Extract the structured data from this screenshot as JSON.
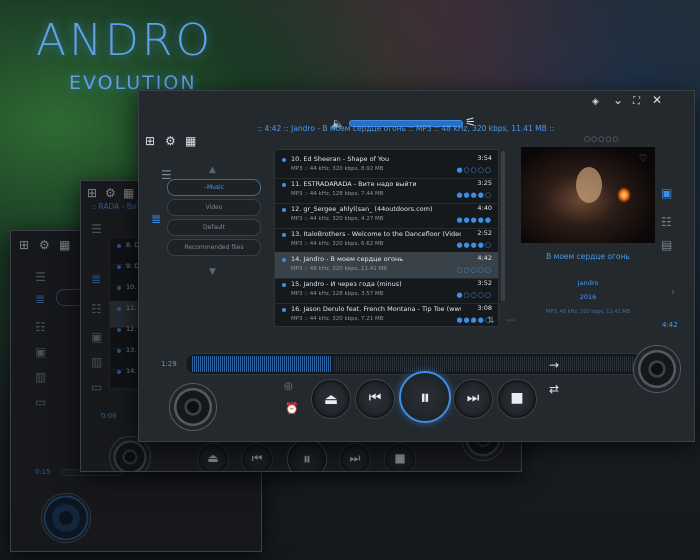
{
  "brand": {
    "title": "ANDRO",
    "subtitle": "EVOLUTION"
  },
  "colors": {
    "accent": "#3d8ee6",
    "bg": "#24292e"
  },
  "now_playing": {
    "line": ":: 4:42 :: Jandro - В моем сердце огонь :: MP3 :: 48 kHz, 320 kbps, 11.41 MB ::",
    "title": "В моем сердце огонь",
    "artist": "Jandro",
    "year": "2016",
    "format": "MP3, 48 kHz, 320 kbps, 11.41 MB",
    "elapsed": "1:29",
    "total": "4:42"
  },
  "nav": {
    "items": [
      "Music",
      "Video",
      "Default",
      "Recommended files"
    ]
  },
  "playlist": [
    {
      "title": "10. Ed Sheeran - Shape of You",
      "meta": "MP3 :: 44 kHz, 320 kbps, 8.92 MB",
      "duration": "3:54",
      "stars": "●○○○○"
    },
    {
      "title": "11. ESTRADARADA - Вите надо выйти",
      "meta": "MP3 :: 44 kHz, 128 kbps, 7.44 MB",
      "duration": "3:25",
      "stars": "●●●●○"
    },
    {
      "title": "12. gr_Sergee_ahlyl(san_ (44outdoors.com)",
      "meta": "MP3 :: 44 kHz, 320 kbps, 4.27 MB",
      "duration": "4:40",
      "stars": "●●●●●"
    },
    {
      "title": "13. ItaloBrothers - Welcome to the Dancefloor (Video Edit)",
      "meta": "MP3 :: 44 kHz, 320 kbps, 6.62 MB",
      "duration": "2:52",
      "stars": "●●●●○"
    },
    {
      "title": "14. Jandro - В моем сердце огонь",
      "meta": "MP3 :: 48 kHz, 320 kbps, 11.41 MB",
      "duration": "4:42",
      "stars": "○○○○○"
    },
    {
      "title": "15. Jandro - И через года (minus)",
      "meta": "MP3 :: 44 kHz, 128 kbps, 3.57 MB",
      "duration": "3:52",
      "stars": "●○○○○"
    },
    {
      "title": "16. Jason Derulo feat. French Montana - Tip Toe (www.rump...",
      "meta": "MP3 :: 44 kHz, 320 kbps, 7.21 MB",
      "duration": "3:08",
      "stars": "●●●●○"
    }
  ],
  "win2": {
    "line": ":: RADA - Вите на...",
    "rows": [
      "8. Dea...",
      "9. DJ ...",
      "10. Ed ...",
      "11. EST...",
      "12. gr_...",
      "13. Ital...",
      "14. Jan..."
    ],
    "time": "0:06"
  },
  "win3": {
    "time": "0:15"
  }
}
